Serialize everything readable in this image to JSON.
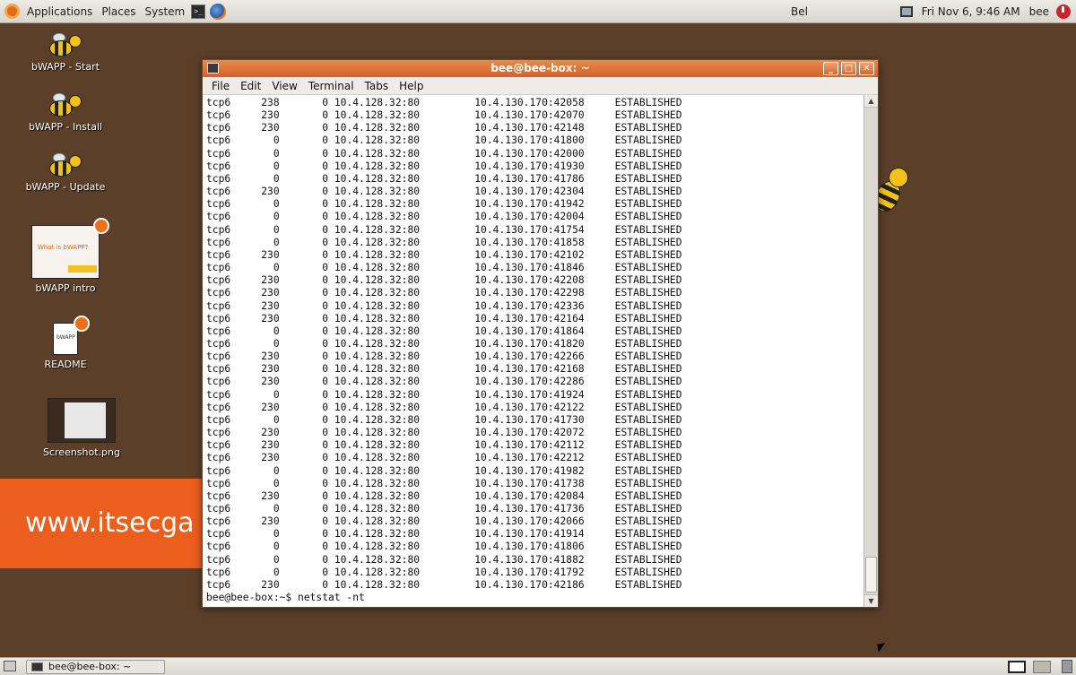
{
  "top_panel": {
    "menus": [
      "Applications",
      "Places",
      "System"
    ],
    "center_text": "Bel",
    "clock": "Fri Nov  6,  9:46 AM",
    "user": "bee"
  },
  "desktop": {
    "icons": [
      {
        "label": "bWAPP - Start",
        "icon": "bee-icon"
      },
      {
        "label": "bWAPP - Install",
        "icon": "bee-icon"
      },
      {
        "label": "bWAPP - Update",
        "icon": "bee-icon"
      },
      {
        "label": "bWAPP intro",
        "icon": "document-thumbnail-icon"
      },
      {
        "label": "README",
        "icon": "text-file-icon"
      },
      {
        "label": "Screenshot.png",
        "icon": "image-thumbnail-icon"
      }
    ],
    "banner_text": "www.itsecga",
    "thumb_text": {
      "intro_title": "What is bWAPP?",
      "readme_text": "bWAPP"
    }
  },
  "terminal": {
    "title": "bee@bee-box: ~",
    "menu": [
      "File",
      "Edit",
      "View",
      "Terminal",
      "Tabs",
      "Help"
    ],
    "local_address": "10.4.128.32:80",
    "state": "ESTABLISHED",
    "rows": [
      {
        "proto": "tcp6",
        "recv": "238",
        "send": "0",
        "foreign": "10.4.130.170:42058"
      },
      {
        "proto": "tcp6",
        "recv": "230",
        "send": "0",
        "foreign": "10.4.130.170:42070"
      },
      {
        "proto": "tcp6",
        "recv": "230",
        "send": "0",
        "foreign": "10.4.130.170:42148"
      },
      {
        "proto": "tcp6",
        "recv": "0",
        "send": "0",
        "foreign": "10.4.130.170:41800"
      },
      {
        "proto": "tcp6",
        "recv": "0",
        "send": "0",
        "foreign": "10.4.130.170:42000"
      },
      {
        "proto": "tcp6",
        "recv": "0",
        "send": "0",
        "foreign": "10.4.130.170:41930"
      },
      {
        "proto": "tcp6",
        "recv": "0",
        "send": "0",
        "foreign": "10.4.130.170:41786"
      },
      {
        "proto": "tcp6",
        "recv": "230",
        "send": "0",
        "foreign": "10.4.130.170:42304"
      },
      {
        "proto": "tcp6",
        "recv": "0",
        "send": "0",
        "foreign": "10.4.130.170:41942"
      },
      {
        "proto": "tcp6",
        "recv": "0",
        "send": "0",
        "foreign": "10.4.130.170:42004"
      },
      {
        "proto": "tcp6",
        "recv": "0",
        "send": "0",
        "foreign": "10.4.130.170:41754"
      },
      {
        "proto": "tcp6",
        "recv": "0",
        "send": "0",
        "foreign": "10.4.130.170:41858"
      },
      {
        "proto": "tcp6",
        "recv": "230",
        "send": "0",
        "foreign": "10.4.130.170:42102"
      },
      {
        "proto": "tcp6",
        "recv": "0",
        "send": "0",
        "foreign": "10.4.130.170:41846"
      },
      {
        "proto": "tcp6",
        "recv": "230",
        "send": "0",
        "foreign": "10.4.130.170:42208"
      },
      {
        "proto": "tcp6",
        "recv": "230",
        "send": "0",
        "foreign": "10.4.130.170:42298"
      },
      {
        "proto": "tcp6",
        "recv": "230",
        "send": "0",
        "foreign": "10.4.130.170:42336"
      },
      {
        "proto": "tcp6",
        "recv": "230",
        "send": "0",
        "foreign": "10.4.130.170:42164"
      },
      {
        "proto": "tcp6",
        "recv": "0",
        "send": "0",
        "foreign": "10.4.130.170:41864"
      },
      {
        "proto": "tcp6",
        "recv": "0",
        "send": "0",
        "foreign": "10.4.130.170:41820"
      },
      {
        "proto": "tcp6",
        "recv": "230",
        "send": "0",
        "foreign": "10.4.130.170:42266"
      },
      {
        "proto": "tcp6",
        "recv": "230",
        "send": "0",
        "foreign": "10.4.130.170:42168"
      },
      {
        "proto": "tcp6",
        "recv": "230",
        "send": "0",
        "foreign": "10.4.130.170:42286"
      },
      {
        "proto": "tcp6",
        "recv": "0",
        "send": "0",
        "foreign": "10.4.130.170:41924"
      },
      {
        "proto": "tcp6",
        "recv": "230",
        "send": "0",
        "foreign": "10.4.130.170:42122"
      },
      {
        "proto": "tcp6",
        "recv": "0",
        "send": "0",
        "foreign": "10.4.130.170:41730"
      },
      {
        "proto": "tcp6",
        "recv": "230",
        "send": "0",
        "foreign": "10.4.130.170:42072"
      },
      {
        "proto": "tcp6",
        "recv": "230",
        "send": "0",
        "foreign": "10.4.130.170:42112"
      },
      {
        "proto": "tcp6",
        "recv": "230",
        "send": "0",
        "foreign": "10.4.130.170:42212"
      },
      {
        "proto": "tcp6",
        "recv": "0",
        "send": "0",
        "foreign": "10.4.130.170:41982"
      },
      {
        "proto": "tcp6",
        "recv": "0",
        "send": "0",
        "foreign": "10.4.130.170:41738"
      },
      {
        "proto": "tcp6",
        "recv": "230",
        "send": "0",
        "foreign": "10.4.130.170:42084"
      },
      {
        "proto": "tcp6",
        "recv": "0",
        "send": "0",
        "foreign": "10.4.130.170:41736"
      },
      {
        "proto": "tcp6",
        "recv": "230",
        "send": "0",
        "foreign": "10.4.130.170:42066"
      },
      {
        "proto": "tcp6",
        "recv": "0",
        "send": "0",
        "foreign": "10.4.130.170:41914"
      },
      {
        "proto": "tcp6",
        "recv": "0",
        "send": "0",
        "foreign": "10.4.130.170:41806"
      },
      {
        "proto": "tcp6",
        "recv": "0",
        "send": "0",
        "foreign": "10.4.130.170:41882"
      },
      {
        "proto": "tcp6",
        "recv": "0",
        "send": "0",
        "foreign": "10.4.130.170:41792"
      },
      {
        "proto": "tcp6",
        "recv": "230",
        "send": "0",
        "foreign": "10.4.130.170:42186"
      }
    ],
    "prompt": "bee@bee-box:~$ netstat -nt"
  },
  "taskbar": {
    "window_button": "bee@bee-box: ~"
  },
  "colors": {
    "desktop_bg": "#5b3f29",
    "title_bar": "#d4622a",
    "banner": "#ec5e1e"
  }
}
